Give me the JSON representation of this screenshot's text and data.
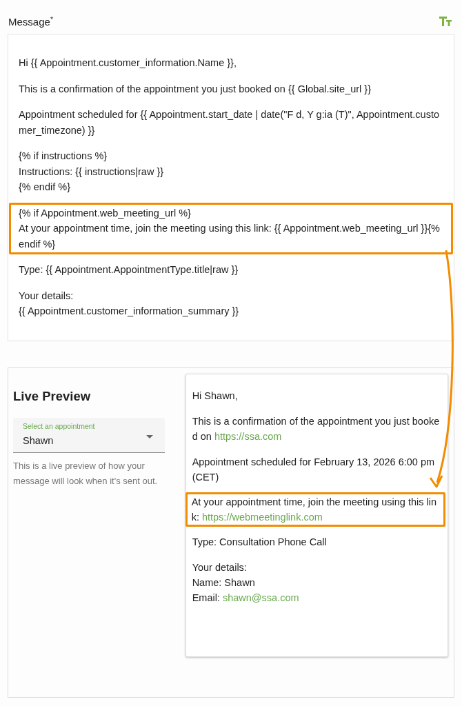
{
  "message_field": {
    "label": "Message",
    "required_mark": "*",
    "paragraphs": [
      {
        "lines": [
          "Hi {{ Appointment.customer_information.Name }},"
        ],
        "highlighted": false
      },
      {
        "lines": [
          "This is a confirmation of the appointment you just booked on {{ Global.site_url }}"
        ],
        "highlighted": false
      },
      {
        "lines": [
          "Appointment scheduled for {{ Appointment.start_date | date(\"F d, Y g:ia (T)\", Appointment.customer_timezone) }}"
        ],
        "highlighted": false
      },
      {
        "lines": [
          "{% if instructions %}",
          "Instructions: {{ instructions|raw }}",
          "{% endif %}"
        ],
        "highlighted": false
      },
      {
        "lines": [
          "{% if Appointment.web_meeting_url %}",
          "At your appointment time, join the meeting using this link: {{ Appointment.web_meeting_url }}{% endif %}"
        ],
        "highlighted": true
      },
      {
        "lines": [
          "Type: {{ Appointment.AppointmentType.title|raw }}"
        ],
        "highlighted": false
      },
      {
        "lines": [
          "Your details:",
          "{{ Appointment.customer_information_summary }}"
        ],
        "highlighted": false
      }
    ]
  },
  "live_preview": {
    "title": "Live Preview",
    "select": {
      "label": "Select an appointment",
      "value": "Shawn"
    },
    "description": "This is a live preview of how your message will look when it's sent out.",
    "paragraphs": [
      {
        "lines": [
          {
            "text": "Hi Shawn,"
          }
        ],
        "highlighted": false
      },
      {
        "lines": [
          {
            "text": "This is a confirmation of the appointment you just booked on ",
            "link": "https://ssa.com"
          }
        ],
        "highlighted": false
      },
      {
        "lines": [
          {
            "text": "Appointment scheduled for February 13, 2026 6:00 pm (CET)"
          }
        ],
        "highlighted": false
      },
      {
        "lines": [
          {
            "text": "At your appointment time, join the meeting using this link: ",
            "link": "https://webmeetinglink.com"
          }
        ],
        "highlighted": true
      },
      {
        "lines": [
          {
            "text": "Type: Consultation Phone Call"
          }
        ],
        "highlighted": false
      },
      {
        "lines": [
          {
            "text": "Your details:"
          },
          {
            "text": "Name: Shawn"
          },
          {
            "text": "Email: ",
            "link": "shawn@ssa.com"
          }
        ],
        "highlighted": false
      }
    ]
  }
}
